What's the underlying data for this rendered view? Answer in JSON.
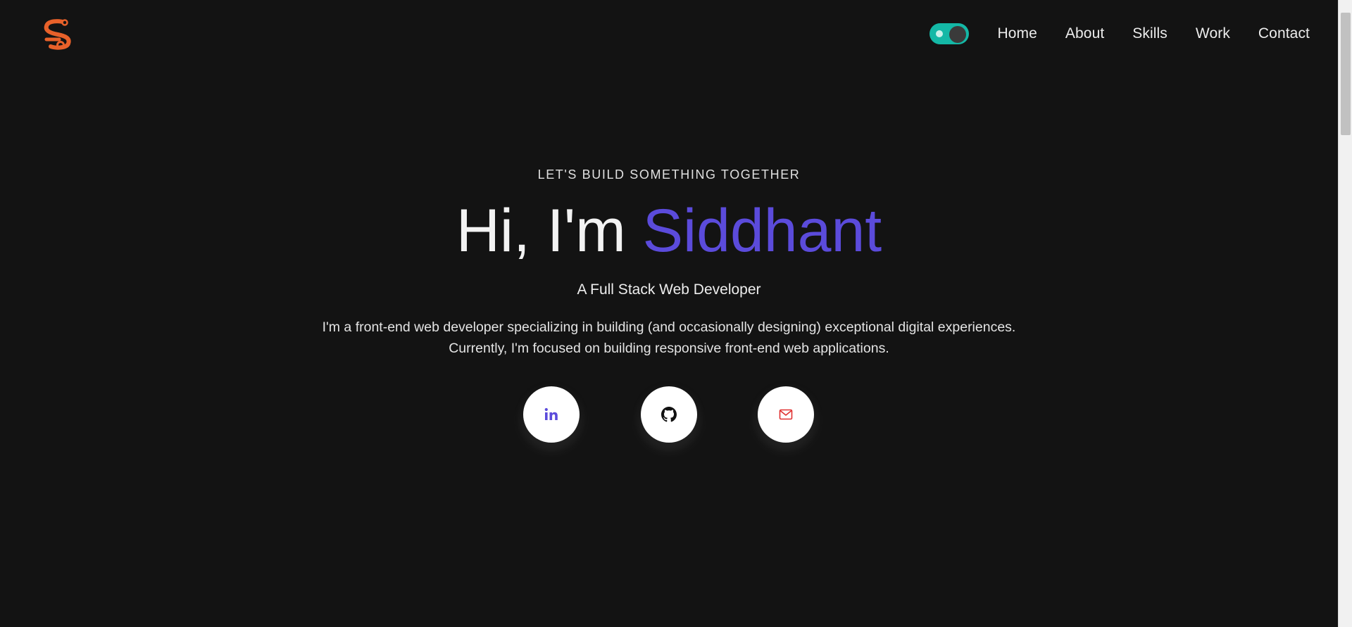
{
  "nav": {
    "items": [
      {
        "label": "Home"
      },
      {
        "label": "About"
      },
      {
        "label": "Skills"
      },
      {
        "label": "Work"
      },
      {
        "label": "Contact"
      }
    ],
    "theme_toggle_color": "#14b8a6"
  },
  "logo": {
    "icon": "s-logo-icon",
    "color": "#e8612a"
  },
  "hero": {
    "eyebrow": "LET'S BUILD SOMETHING TOGETHER",
    "greeting": "Hi, I'm ",
    "name": "Siddhant",
    "name_color": "#5b4bdb",
    "subtitle": "A Full Stack Web Developer",
    "bio_line1": "I'm a front-end web developer specializing in building (and occasionally designing) exceptional digital experiences.",
    "bio_line2": "Currently, I'm focused on building responsive front-end web applications."
  },
  "socials": [
    {
      "icon": "linkedin-icon",
      "color": "#5b4bdb"
    },
    {
      "icon": "github-icon",
      "color": "#111111"
    },
    {
      "icon": "mail-icon",
      "color": "#e03131"
    }
  ]
}
